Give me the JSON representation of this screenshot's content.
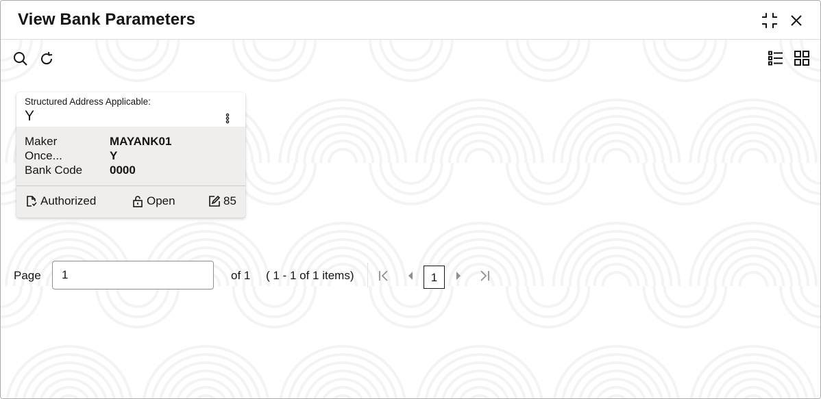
{
  "dialog": {
    "title": "View Bank Parameters",
    "header_actions": [
      {
        "icon": "collapse-icon",
        "label": "Minimize"
      },
      {
        "icon": "close-icon",
        "label": "Close"
      }
    ]
  },
  "toolbar": {
    "left_icons": [
      "search-icon",
      "refresh-icon"
    ],
    "right_icons": [
      "list-view-icon",
      "grid-view-icon"
    ]
  },
  "card": {
    "header_label": "Structured Address Applicable:",
    "header_value": "Y",
    "menu_icon": "kebab-menu-icon",
    "fields": [
      {
        "key": "Maker",
        "value": "MAYANK01"
      },
      {
        "key": "Once...",
        "value": "Y"
      },
      {
        "key": "Bank Code",
        "value": "0000"
      }
    ],
    "footer": {
      "auth_status": "Authorized",
      "record_status": "Open",
      "modification_count": "85"
    }
  },
  "pagination": {
    "page_label": "Page",
    "page_input_value": "1",
    "of_label": "of 1",
    "range_label": "( 1 - 1 of 1 items)",
    "current_page": "1"
  },
  "colors": {
    "text": "#161513",
    "card_body_bg": "#efeeed",
    "disabled_icon": "#8f8f8f"
  }
}
